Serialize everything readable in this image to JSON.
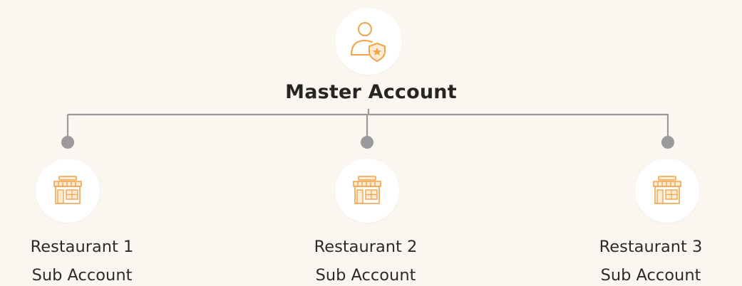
{
  "master": {
    "title": "Master Account",
    "icon": "user-shield-star-icon"
  },
  "subaccounts": [
    {
      "name": "Restaurant 1",
      "type": "Sub Account",
      "icon": "storefront-icon"
    },
    {
      "name": "Restaurant 2",
      "type": "Sub Account",
      "icon": "storefront-icon"
    },
    {
      "name": "Restaurant 3",
      "type": "Sub Account",
      "icon": "storefront-icon"
    }
  ],
  "colors": {
    "background": "#fbf6f0",
    "accent": "#f0a44a",
    "connector": "#9a9a9a",
    "text": "#2b2b2b"
  }
}
